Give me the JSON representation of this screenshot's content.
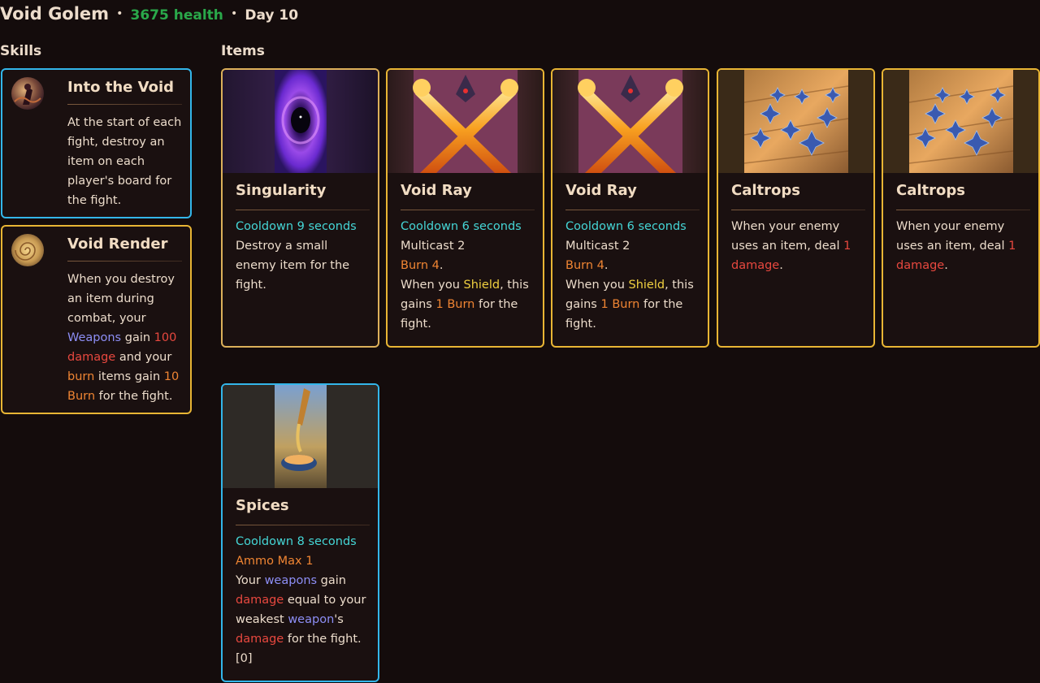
{
  "header": {
    "name": "Void Golem",
    "health": "3675 health",
    "day": "Day 10",
    "separator": "•"
  },
  "sections": {
    "skills": "Skills",
    "items": "Items"
  },
  "skills": [
    {
      "name": "Into the Void",
      "lines": [
        "At the start of each",
        "fight, destroy an",
        "item on each",
        "player's board for",
        "the fight."
      ]
    },
    {
      "name": "Void Render",
      "l1": "When you destroy",
      "l2": "an item during",
      "l3": "combat, your",
      "l4a": "Weapons",
      "l4b": " gain ",
      "l4c": "100",
      "l5a": "damage",
      "l5b": " and your",
      "l6a": "burn",
      "l6b": " items gain ",
      "l6c": "10",
      "l7a": "Burn",
      "l7b": " for the fight."
    }
  ],
  "items": [
    {
      "name": "Singularity",
      "cooldown": "Cooldown 9 seconds",
      "lines": [
        "Destroy a small",
        "enemy item for the",
        "fight."
      ]
    },
    {
      "name": "Void Ray",
      "cooldown": "Cooldown 6 seconds",
      "multicast": "Multicast 2",
      "burn": "Burn 4",
      "burn_end": ".",
      "l1a": "When you ",
      "l1b": "Shield",
      "l1c": ", this",
      "l2a": "gains ",
      "l2b": "1 Burn",
      "l2c": " for the",
      "l3": "fight."
    },
    {
      "name": "Void Ray",
      "cooldown": "Cooldown 6 seconds",
      "multicast": "Multicast 2",
      "burn": "Burn 4",
      "burn_end": ".",
      "l1a": "When you ",
      "l1b": "Shield",
      "l1c": ", this",
      "l2a": "gains ",
      "l2b": "1 Burn",
      "l2c": " for the",
      "l3": "fight."
    },
    {
      "name": "Caltrops",
      "l1": "When your enemy",
      "l2a": "uses an item, deal ",
      "l2b": "1",
      "l3a": "damage",
      "l3b": "."
    },
    {
      "name": "Caltrops",
      "l1": "When your enemy",
      "l2a": "uses an item, deal ",
      "l2b": "1",
      "l3a": "damage",
      "l3b": "."
    },
    {
      "name": "Spices",
      "cooldown": "Cooldown 8 seconds",
      "ammo": "Ammo Max 1",
      "l1a": "Your ",
      "l1b": "weapons",
      "l1c": " gain",
      "l2a": "damage",
      "l2b": " equal to your",
      "l3a": "weakest ",
      "l3b": "weapon",
      "l3c": "'s",
      "l4a": "damage",
      "l4b": " for the fight.",
      "l5": "[0]"
    }
  ],
  "colors": {
    "background": "#140c0c",
    "health": "#2aa84a",
    "cooldown": "#45d6d6",
    "damage": "#e8483f",
    "burn": "#f08533",
    "shield": "#f0d040",
    "weapon": "#8d8ef5",
    "gold_border": "#e8b534",
    "blue_border": "#33b6ea"
  }
}
